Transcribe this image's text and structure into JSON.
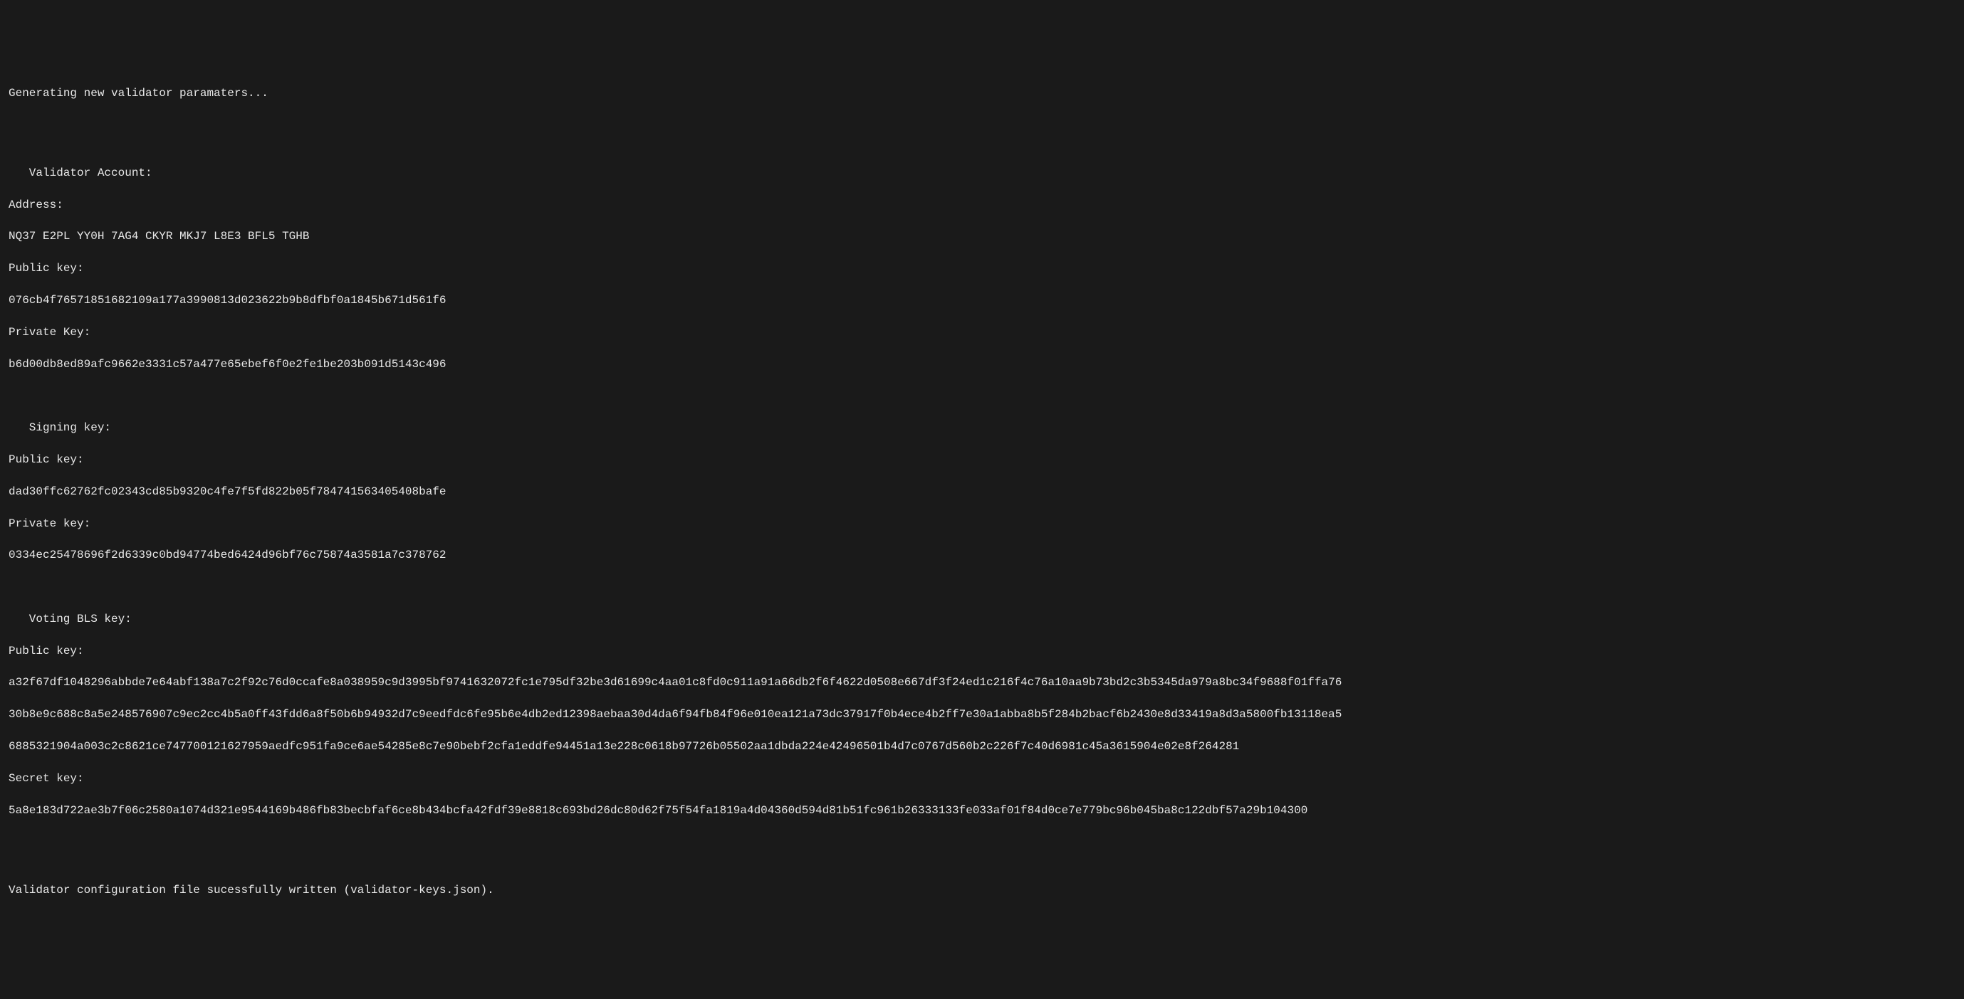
{
  "terminal": {
    "generating": "Generating new validator paramaters...",
    "validatorAccount": {
      "header": "Validator Account:",
      "addressLabel": "Address:",
      "address": "NQ37 E2PL YY0H 7AG4 CKYR MKJ7 L8E3 BFL5 TGHB",
      "publicKeyLabel": "Public key:",
      "publicKey": "076cb4f76571851682109a177a3990813d023622b9b8dfbf0a1845b671d561f6",
      "privateKeyLabel": "Private Key:",
      "privateKey": "b6d00db8ed89afc9662e3331c57a477e65ebef6f0e2fe1be203b091d5143c496"
    },
    "signingKey": {
      "header": "Signing key:",
      "publicKeyLabel": "Public key:",
      "publicKey": "dad30ffc62762fc02343cd85b9320c4fe7f5fd822b05f784741563405408bafe",
      "privateKeyLabel": "Private key:",
      "privateKey": "0334ec25478696f2d6339c0bd94774bed6424d96bf76c75874a3581a7c378762"
    },
    "votingBlsKey": {
      "header": "Voting BLS key:",
      "publicKeyLabel": "Public key:",
      "publicKeyLine1": "a32f67df1048296abbde7e64abf138a7c2f92c76d0ccafe8a038959c9d3995bf9741632072fc1e795df32be3d61699c4aa01c8fd0c911a91a66db2f6f4622d0508e667df3f24ed1c216f4c76a10aa9b73bd2c3b5345da979a8bc34f9688f01ffa76",
      "publicKeyLine2": "30b8e9c688c8a5e248576907c9ec2cc4b5a0ff43fdd6a8f50b6b94932d7c9eedfdc6fe95b6e4db2ed12398aebaa30d4da6f94fb84f96e010ea121a73dc37917f0b4ece4b2ff7e30a1abba8b5f284b2bacf6b2430e8d33419a8d3a5800fb13118ea5",
      "publicKeyLine3": "6885321904a003c2c8621ce747700121627959aedfc951fa9ce6ae54285e8c7e90bebf2cfa1eddfe94451a13e228c0618b97726b05502aa1dbda224e42496501b4d7c0767d560b2c226f7c40d6981c45a3615904e02e8f264281",
      "secretKeyLabel": "Secret key:",
      "secretKey": "5a8e183d722ae3b7f06c2580a1074d321e9544169b486fb83becbfaf6ce8b434bcfa42fdf39e8818c693bd26dc80d62f75f54fa1819a4d04360d594d81b51fc961b26333133fe033af01f84d0ce7e779bc96b045ba8c122dbf57a29b104300"
    },
    "configWritten": "Validator configuration file sucessfully written (validator-keys.json)."
  }
}
